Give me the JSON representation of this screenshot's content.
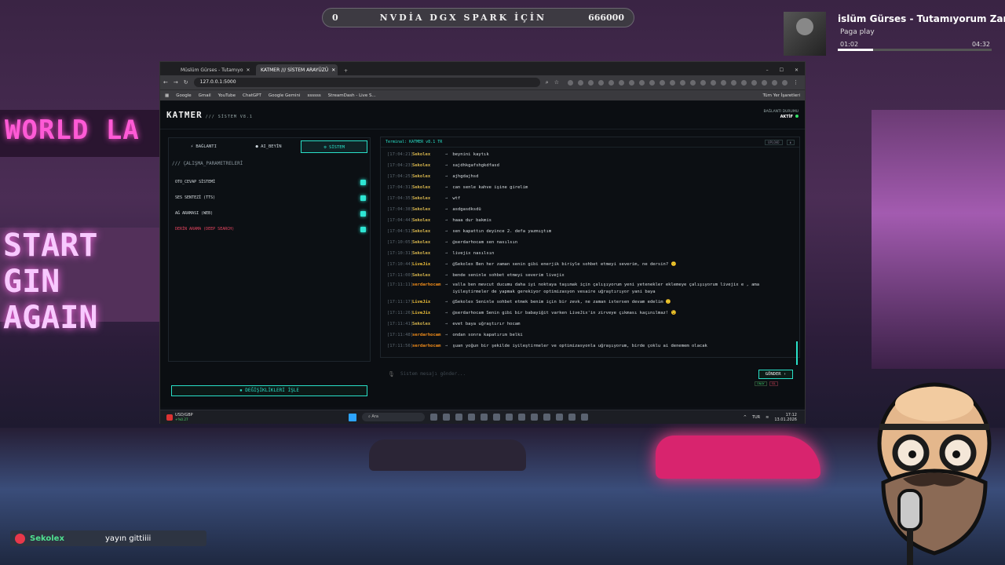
{
  "overlay": {
    "left_count": "0",
    "title": "NVDİA DGX SPARK İÇİN",
    "right_count": "666000"
  },
  "music": {
    "title": "islüm Gürses - Tutamıyorum Zama",
    "artist": "Paga play",
    "elapsed": "01:02",
    "duration": "04:32",
    "progress": 0.23
  },
  "chat_toast": {
    "user": "Sekolex",
    "message": "yayın gittiiii"
  },
  "browser": {
    "tabs": [
      {
        "label": "Müslüm Gürses - Tutamıyo"
      },
      {
        "label": "KATMER /// SİSTEM ARAYÜZÜ"
      }
    ],
    "url": "127.0.0.1:5000",
    "bookmarks": [
      "Google",
      "Gmail",
      "YouTube",
      "ChatGPT",
      "Google Gemini",
      "ssssss",
      "StreamDash - Live S..."
    ],
    "bookmarks_right": "Tüm Yer İşaretleri"
  },
  "app": {
    "brand": "KATMER",
    "version": "/// SİSTEM V8.1",
    "conn_label": "BAĞLANTI DURUMU",
    "conn_status": "AKTİF",
    "tabs": [
      {
        "label": "BAĞLANTI",
        "icon": "plug-icon"
      },
      {
        "label": "AI_BEYİN",
        "icon": "brain-icon"
      },
      {
        "label": "SİSTEM",
        "icon": "gear-icon"
      }
    ],
    "section_title": "/// ÇALIŞMA_PARAMETRELERİ",
    "options": [
      {
        "label": "OTO_CEVAP SİSTEMİ",
        "on": true
      },
      {
        "label": "SES SENTEZİ (TTS)",
        "on": true
      },
      {
        "label": "AĞ ARAMASI (WEB)",
        "on": true
      },
      {
        "label": "DERİN ARAMA (DEEP SEARCH)",
        "on": true
      }
    ],
    "apply_label": "DEĞİŞİKLİKLERİ İŞLE",
    "terminal_title": "Terminal: KATMER v8.1 TR",
    "terminal_btn": "UPLOAD",
    "input_placeholder": "Sistem mesajı gönder...",
    "send_label": "GÖNDER",
    "mini_buttons": [
      "ONAY",
      "SİL"
    ],
    "log": [
      {
        "ts": "[17:04:21]",
        "user": "Sekolex",
        "kind": "so",
        "msg": "beynini kaytık"
      },
      {
        "ts": "[17:04:23]",
        "user": "Sekolex",
        "kind": "so",
        "msg": "sajdhkgafshgkdfasd"
      },
      {
        "ts": "[17:04:25]",
        "user": "Sekolex",
        "kind": "so",
        "msg": "ajhgdajhsd"
      },
      {
        "ts": "[17:04:31]",
        "user": "Sekolex",
        "kind": "so",
        "msg": "can senle kahve işine girelim"
      },
      {
        "ts": "[17:04:35]",
        "user": "Sekolex",
        "kind": "so",
        "msg": "wtf"
      },
      {
        "ts": "[17:04:38]",
        "user": "Sekolex",
        "kind": "so",
        "msg": "asdgasdksdü"
      },
      {
        "ts": "[17:04:44]",
        "user": "Sekolex",
        "kind": "so",
        "msg": "haaa dur bakmis"
      },
      {
        "ts": "[17:04:51]",
        "user": "Sekolex",
        "kind": "so",
        "msg": "sen kapattın deyince 2. defa yazmıştım"
      },
      {
        "ts": "[17:10:05]",
        "user": "Sekolex",
        "kind": "so",
        "msg": "@serdarhocam sen nasılsın"
      },
      {
        "ts": "[17:10:31]",
        "user": "Sekolex",
        "kind": "so",
        "msg": "livejix nasılsın"
      },
      {
        "ts": "[17:10:44]",
        "user": "LiveJix",
        "kind": "li",
        "msg": "@Sekolex Ben her zaman senin gibi enerjik biriyle sohbet etmeyi severim, ne dersin? 🙂"
      },
      {
        "ts": "[17:11:00]",
        "user": "Sekolex",
        "kind": "so",
        "msg": "bende seninle sohbet etmeyi severim livejix"
      },
      {
        "ts": "[17:11:11]",
        "user": "serdarhocam",
        "kind": "se",
        "msg": "valla ben mevcut ducumu daha iyi noktaya taşımak için çalışıyorum yeni yetenekler eklemeye çalışıyorum livejix e , ama iyileştirmeler de yapmak gerekiyor optimizasyon vesaire uğraştırıyor yani baya",
        "wrap": true
      },
      {
        "ts": "[17:11:17]",
        "user": "LiveJix",
        "kind": "li",
        "msg": "@Sekolex Seninle sohbet etmek benim için bir zevk, ne zaman istersen devam edelim 🙂"
      },
      {
        "ts": "[17:11:26]",
        "user": "LiveJix",
        "kind": "li",
        "msg": "@serdarhocam Senin gibi bir babayiğit varken LiveJix'in zirveye çıkması kaçınılmaz! 😉"
      },
      {
        "ts": "[17:11:41]",
        "user": "Sekolex",
        "kind": "so",
        "msg": "evet baya uğraştırır hocam"
      },
      {
        "ts": "[17:11:48]",
        "user": "serdarhocam",
        "kind": "se",
        "msg": "ondan sonra kapatırım belki"
      },
      {
        "ts": "[17:11:56]",
        "user": "serdarhocam",
        "kind": "se",
        "msg": "şuan yoğun bir şekilde iyileştirmeler ve optimizasyonla uğraşıyorum, birde çoklu ai denemem olacak"
      }
    ]
  },
  "taskbar": {
    "ticker": "USD/GBP",
    "ticker_change": "+%0.27",
    "search": "Ara",
    "lang": "TUR",
    "time": "17:12",
    "date": "13.01.2026"
  },
  "background": {
    "sign_text": "WORLD LA",
    "start_text_1": "START",
    "start_text_2": "GIN AGAIN"
  },
  "colors": {
    "accent": "#29e0c8",
    "ok": "#36e36a",
    "danger": "#e84560"
  }
}
